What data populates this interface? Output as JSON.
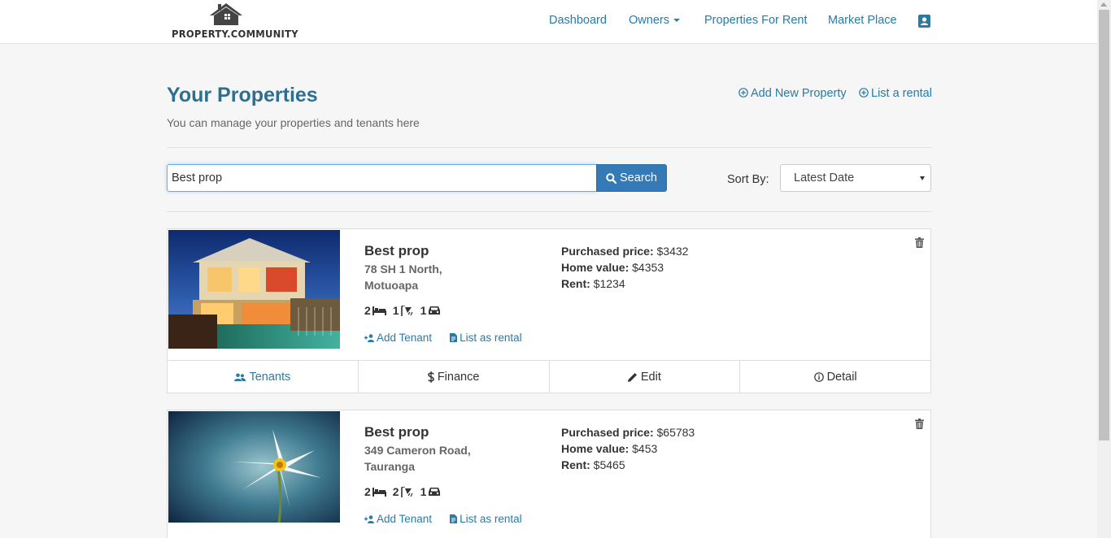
{
  "brand": {
    "logo_text": "PROPERTY.COMMUNITY"
  },
  "nav": {
    "dashboard": "Dashboard",
    "owners": "Owners",
    "properties_for_rent": "Properties For Rent",
    "market_place": "Market Place"
  },
  "header": {
    "title": "Your Properties",
    "subtitle": "You can manage your properties and tenants here",
    "add_new_property": "Add New Property",
    "list_rental": "List a rental"
  },
  "search": {
    "value": "Best prop",
    "button_label": "Search"
  },
  "sort": {
    "label": "Sort By:",
    "selected": "Latest Date"
  },
  "colors": {
    "accent": "#2a7aa6",
    "title": "#2f6f8e",
    "button": "#337ab7"
  },
  "properties": [
    {
      "name": "Best prop",
      "address_line1": "78 SH 1 North,",
      "address_line2": "Motuoapa",
      "bedrooms": "2",
      "bathrooms": "1",
      "parking": "1",
      "purchased_label": "Purchased price:",
      "purchased_price": "$3432",
      "home_value_label": "Home value:",
      "home_value": "$4353",
      "rent_label": "Rent:",
      "rent": "$1234",
      "add_tenant": "Add Tenant",
      "list_as_rental": "List as rental",
      "tabs": {
        "tenants": "Tenants",
        "finance": "Finance",
        "edit": "Edit",
        "detail": "Detail"
      }
    },
    {
      "name": "Best prop",
      "address_line1": "349 Cameron Road,",
      "address_line2": "Tauranga",
      "bedrooms": "2",
      "bathrooms": "2",
      "parking": "1",
      "purchased_label": "Purchased price:",
      "purchased_price": "$65783",
      "home_value_label": "Home value:",
      "home_value": "$453",
      "rent_label": "Rent:",
      "rent": "$5465",
      "add_tenant": "Add Tenant",
      "list_as_rental": "List as rental"
    }
  ]
}
